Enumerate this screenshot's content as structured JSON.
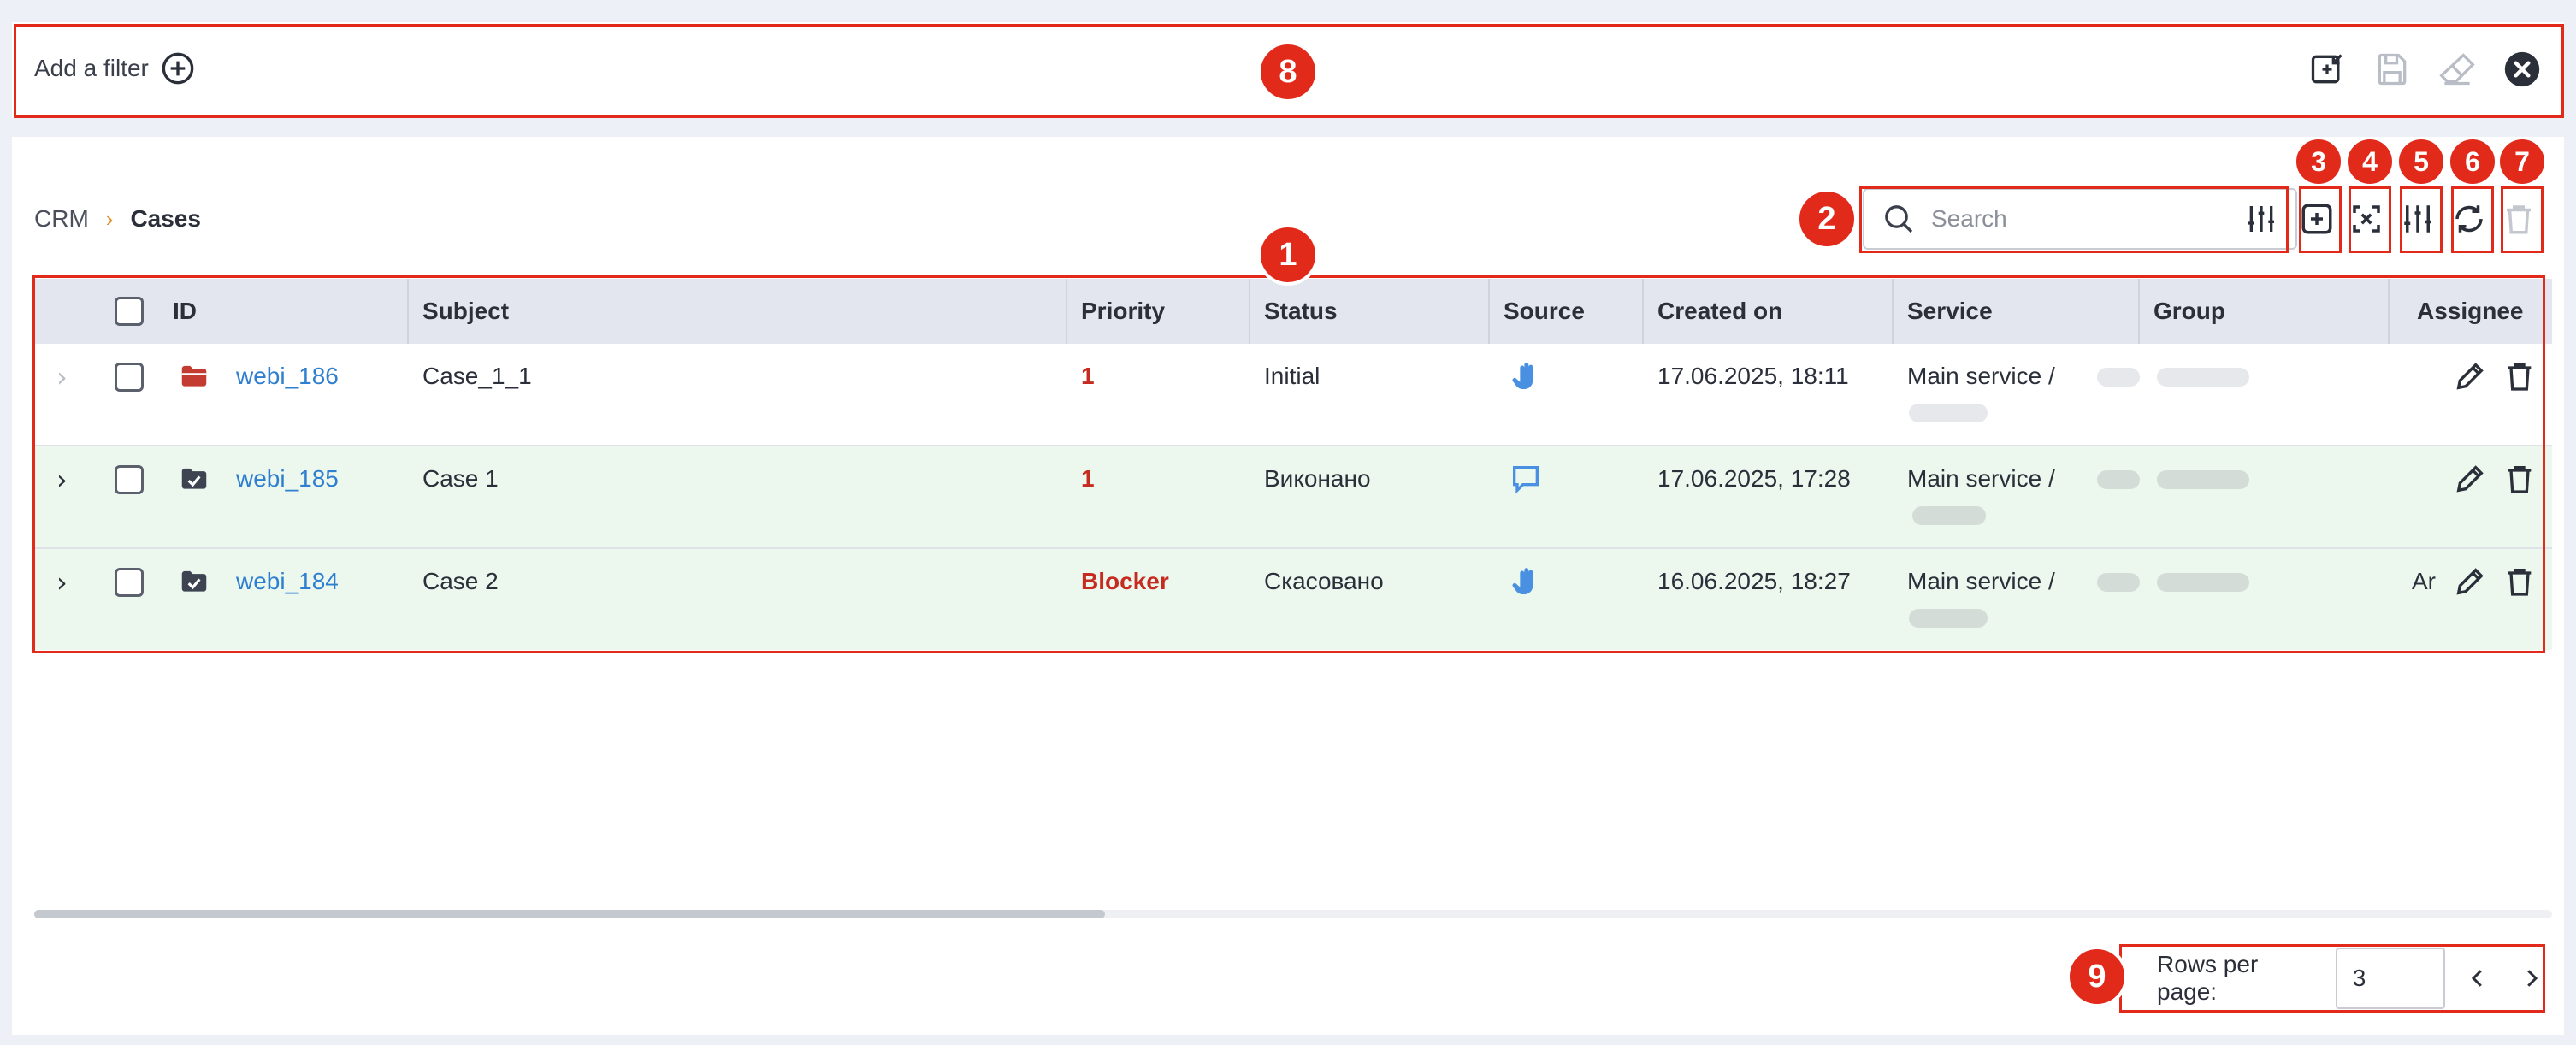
{
  "filter_bar": {
    "add_filter_label": "Add a filter",
    "actions": [
      "import-filter-icon",
      "save-filter-icon",
      "clear-filter-icon",
      "close-icon"
    ]
  },
  "breadcrumb": {
    "root": "CRM",
    "separator": "›",
    "current": "Cases"
  },
  "search": {
    "placeholder": "Search",
    "value": ""
  },
  "toolbar": {
    "buttons": [
      "add-icon",
      "expand-icon",
      "columns-settings-icon",
      "refresh-icon",
      "delete-icon"
    ]
  },
  "table": {
    "columns": [
      "ID",
      "Subject",
      "Priority",
      "Status",
      "Source",
      "Created on",
      "Service",
      "Group",
      "Assignee"
    ],
    "rows": [
      {
        "id": "webi_186",
        "subject": "Case_1_1",
        "priority": "1",
        "status": "Initial",
        "source": "hand-icon",
        "created": "17.06.2025, 18:11",
        "service": "Main service /",
        "assignee": ""
      },
      {
        "id": "webi_185",
        "subject": "Case 1",
        "priority": "1",
        "status": "Виконано",
        "source": "chat-icon",
        "created": "17.06.2025, 17:28",
        "service": "Main service /",
        "assignee": ""
      },
      {
        "id": "webi_184",
        "subject": "Case 2",
        "priority": "Blocker",
        "status": "Скасовано",
        "source": "hand-icon",
        "created": "16.06.2025, 18:27",
        "service": "Main service /",
        "assignee": "Ar"
      }
    ]
  },
  "pagination": {
    "label": "Rows per page:",
    "value": "3"
  },
  "annotations": [
    "1",
    "2",
    "3",
    "4",
    "5",
    "6",
    "7",
    "8",
    "9"
  ],
  "colors": {
    "accent_red": "#e22a1b",
    "link_blue": "#2f7fd0",
    "row_green": "#ecf8ee",
    "priority_red": "#c62b1f",
    "header_bg": "#e3e6ee"
  }
}
